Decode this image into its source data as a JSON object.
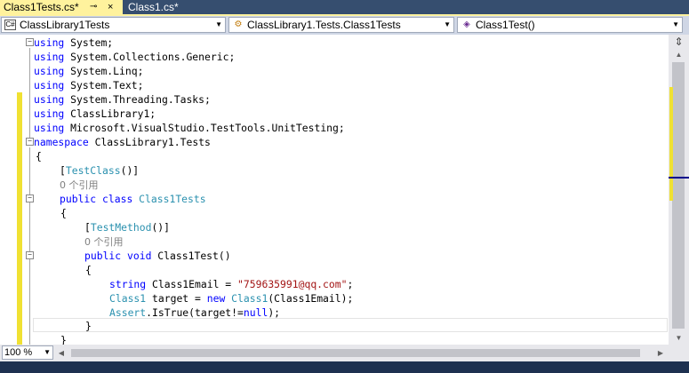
{
  "tabs": [
    {
      "label": "Class1Tests.cs*",
      "pin": "⊸",
      "close": "×",
      "active": true
    },
    {
      "label": "Class1.cs*",
      "active": false
    }
  ],
  "nav": {
    "project": "ClassLibrary1Tests",
    "type": "ClassLibrary1.Tests.Class1Tests",
    "member": "Class1Test()"
  },
  "zoom": {
    "value": "100 %"
  },
  "code": {
    "l1": {
      "kw": "using",
      "rest": " System;"
    },
    "l2": {
      "kw": "using",
      "rest": " System.Collections.Generic;"
    },
    "l3": {
      "kw": "using",
      "rest": " System.Linq;"
    },
    "l4": {
      "kw": "using",
      "rest": " System.Text;"
    },
    "l5": {
      "kw": "using",
      "rest": " System.Threading.Tasks;"
    },
    "l6": {
      "kw": "using",
      "rest": " ClassLibrary1;"
    },
    "l7": {
      "kw": "using",
      "rest": " Microsoft.VisualStudio.TestTools.UnitTesting;"
    },
    "l8": {
      "kw": "namespace",
      "rest": " ClassLibrary1.Tests"
    },
    "l9": {
      "text": "{"
    },
    "l10": {
      "open": "[",
      "attr": "TestClass",
      "close": "()]"
    },
    "l11": {
      "refs": "0 个引用"
    },
    "l12": {
      "kw1": "public",
      "kw2": " class",
      "name": " Class1Tests"
    },
    "l13": {
      "text": "{"
    },
    "l14": {
      "open": "[",
      "attr": "TestMethod",
      "close": "()]"
    },
    "l15": {
      "refs": "0 个引用"
    },
    "l16": {
      "kw1": "public",
      "kw2": " void",
      "rest": " Class1Test()"
    },
    "l17": {
      "text": "{"
    },
    "l18": {
      "kw": "string",
      "mid": " Class1Email = ",
      "str": "\"759635991@qq.com\"",
      "end": ";"
    },
    "l19": {
      "ty": "Class1",
      "mid": " target = ",
      "kw": "new",
      "ty2": " Class1",
      "end": "(Class1Email);"
    },
    "l20": {
      "ty": "Assert",
      "mid": ".IsTrue(target!=",
      "kw": "null",
      "end": ");"
    },
    "l21": {
      "text": "}"
    },
    "l22": {
      "text": "}"
    }
  },
  "colors": {
    "active_tab": "#FFF29D",
    "keyword": "#0000FF",
    "type": "#2B91AF",
    "string": "#A31515",
    "comment": "#808080",
    "change_marker": "#F0E132"
  }
}
